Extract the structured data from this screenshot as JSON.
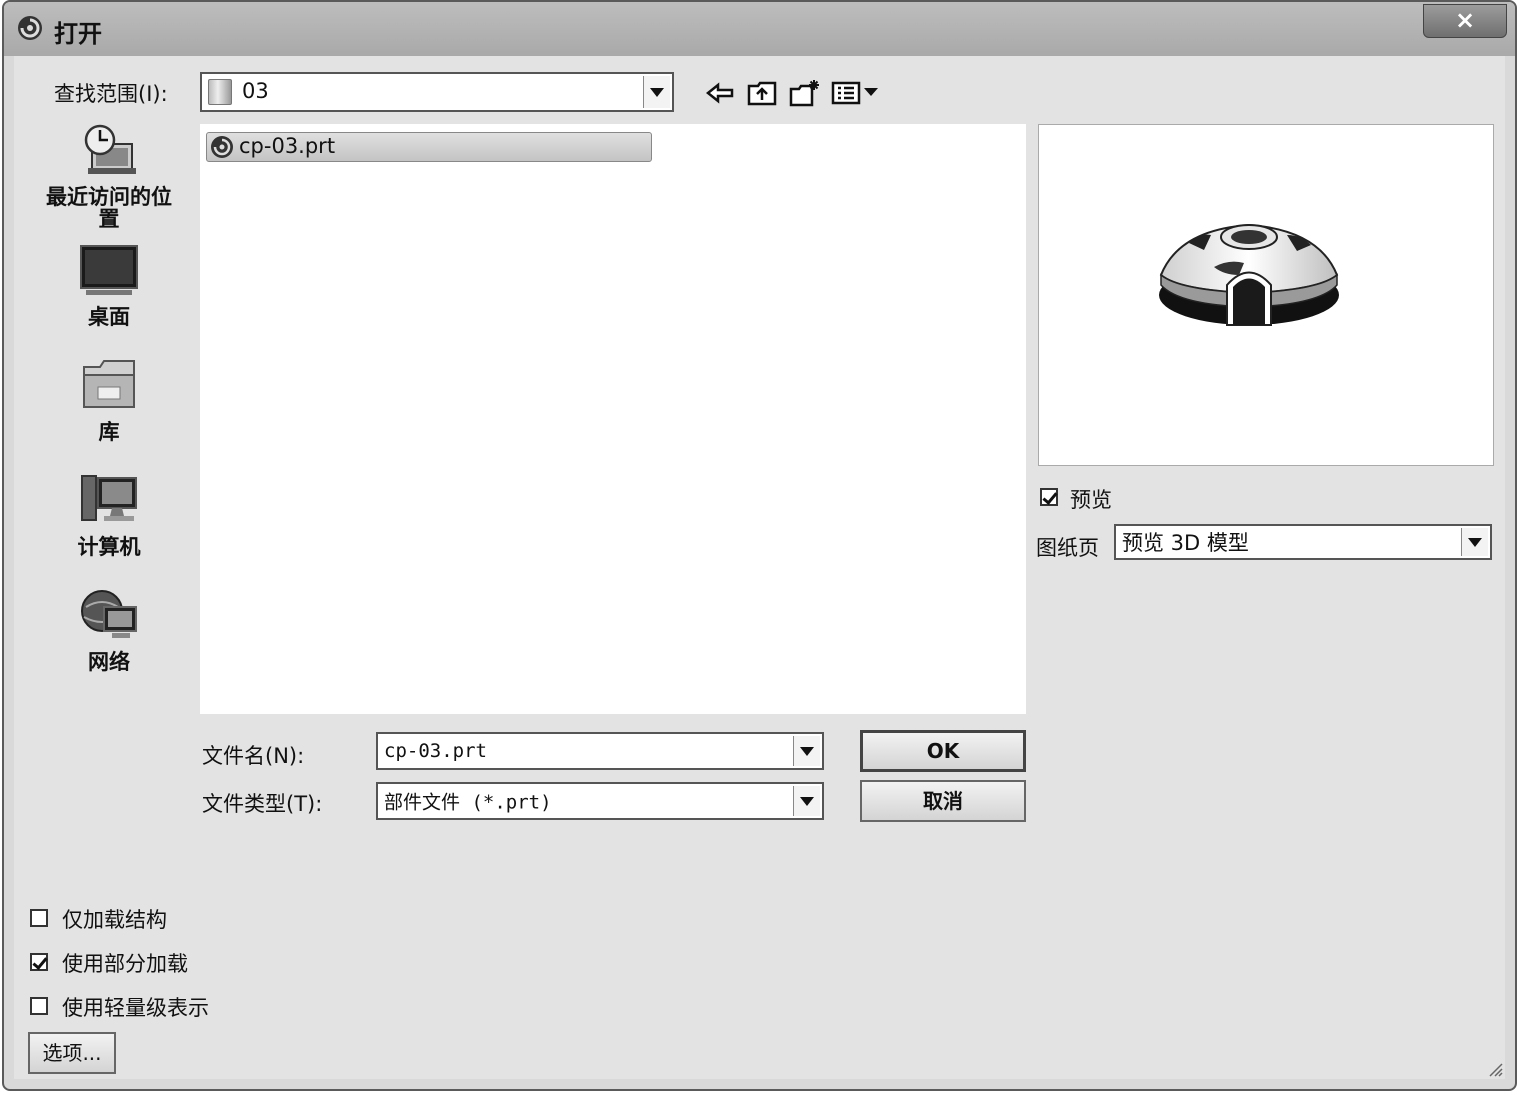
{
  "window": {
    "title": "打开",
    "close_label": "×"
  },
  "toolbar": {
    "look_in_label": "查找范围(I):",
    "look_in_value": "03",
    "icons": [
      "back-arrow-icon",
      "up-folder-icon",
      "new-folder-icon",
      "view-menu-icon"
    ]
  },
  "places": [
    {
      "label": "最近访问的位置",
      "icon": "recent-places-icon"
    },
    {
      "label": "桌面",
      "icon": "desktop-icon"
    },
    {
      "label": "库",
      "icon": "libraries-icon"
    },
    {
      "label": "计算机",
      "icon": "computer-icon"
    },
    {
      "label": "网络",
      "icon": "network-icon"
    }
  ],
  "files": [
    {
      "name": "cp-03.prt",
      "selected": true,
      "icon": "part-file-icon"
    }
  ],
  "preview": {
    "checkbox_label": "预览",
    "checked": true,
    "sheet_label": "图纸页",
    "sheet_value": "预览 3D 模型"
  },
  "form": {
    "filename_label": "文件名(N):",
    "filename_value": "cp-03.prt",
    "filetype_label": "文件类型(T):",
    "filetype_value": "部件文件 (*.prt)",
    "ok_label": "OK",
    "cancel_label": "取消"
  },
  "options": [
    {
      "label": "仅加载结构",
      "checked": false
    },
    {
      "label": "使用部分加载",
      "checked": true
    },
    {
      "label": "使用轻量级表示",
      "checked": false
    }
  ],
  "options_button": "选项..."
}
